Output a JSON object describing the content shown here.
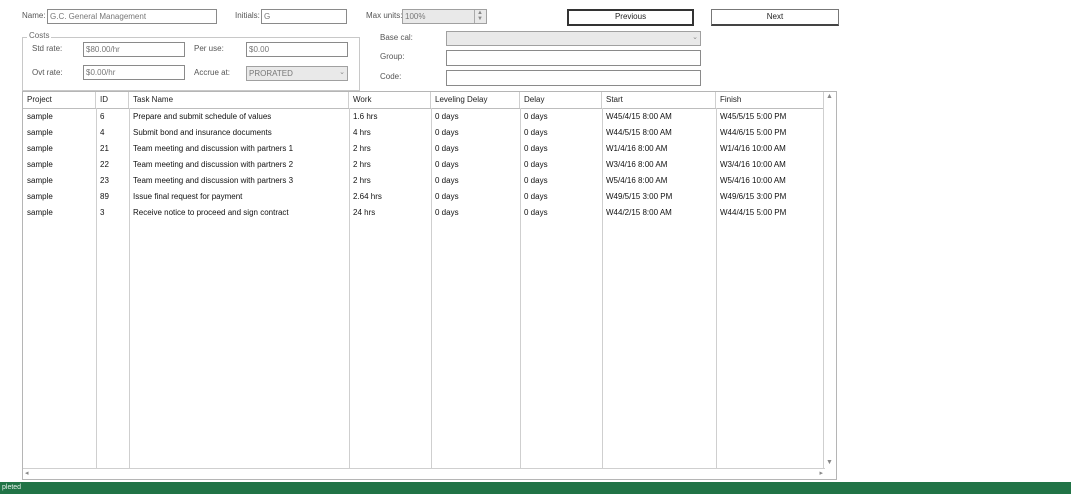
{
  "form": {
    "name_label": "Name:",
    "name_value": "G.C. General Management",
    "initials_label": "Initials:",
    "initials_value": "G",
    "max_units_label": "Max units:",
    "max_units_value": "100%",
    "previous_label": "Previous",
    "next_label": "Next",
    "costs_title": "Costs",
    "std_rate_label": "Std rate:",
    "std_rate_value": "$80.00/hr",
    "per_use_label": "Per use:",
    "per_use_value": "$0.00",
    "ovt_rate_label": "Ovt rate:",
    "ovt_rate_value": "$0.00/hr",
    "accrue_label": "Accrue at:",
    "accrue_value": "PRORATED",
    "base_cal_label": "Base cal:",
    "base_cal_value": "",
    "group_label": "Group:",
    "group_value": "",
    "code_label": "Code:",
    "code_value": ""
  },
  "table": {
    "columns": [
      "Project",
      "ID",
      "Task Name",
      "Work",
      "Leveling Delay",
      "Delay",
      "Start",
      "Finish"
    ],
    "rows": [
      [
        "sample",
        "6",
        "Prepare and submit schedule of values",
        "1.6 hrs",
        "0 days",
        "0 days",
        "W45/4/15 8:00 AM",
        "W45/5/15 5:00 PM"
      ],
      [
        "sample",
        "4",
        "Submit bond and insurance documents",
        "4 hrs",
        "0 days",
        "0 days",
        "W44/5/15 8:00 AM",
        "W44/6/15 5:00 PM"
      ],
      [
        "sample",
        "21",
        "Team meeting and discussion with partners 1",
        "2 hrs",
        "0 days",
        "0 days",
        "W1/4/16 8:00 AM",
        "W1/4/16 10:00 AM"
      ],
      [
        "sample",
        "22",
        "Team meeting and discussion with partners 2",
        "2 hrs",
        "0 days",
        "0 days",
        "W3/4/16 8:00 AM",
        "W3/4/16 10:00 AM"
      ],
      [
        "sample",
        "23",
        "Team meeting and discussion with partners 3",
        "2 hrs",
        "0 days",
        "0 days",
        "W5/4/16 8:00 AM",
        "W5/4/16 10:00 AM"
      ],
      [
        "sample",
        "89",
        "Issue final request for payment",
        "2.64 hrs",
        "0 days",
        "0 days",
        "W49/5/15 3:00 PM",
        "W49/6/15 3:00 PM"
      ],
      [
        "sample",
        "3",
        "Receive notice to proceed and sign contract",
        "24 hrs",
        "0 days",
        "0 days",
        "W44/2/15 8:00 AM",
        "W44/4/15 5:00 PM"
      ]
    ]
  },
  "status": {
    "text": "pleted"
  },
  "colors": {
    "statusbar": "#217346"
  },
  "icons": {
    "dropdown": "chevron-down-icon",
    "scroll_up": "scroll-up-icon",
    "scroll_down": "scroll-down-icon",
    "scroll_left": "scroll-left-icon",
    "scroll_right": "scroll-right-icon"
  }
}
